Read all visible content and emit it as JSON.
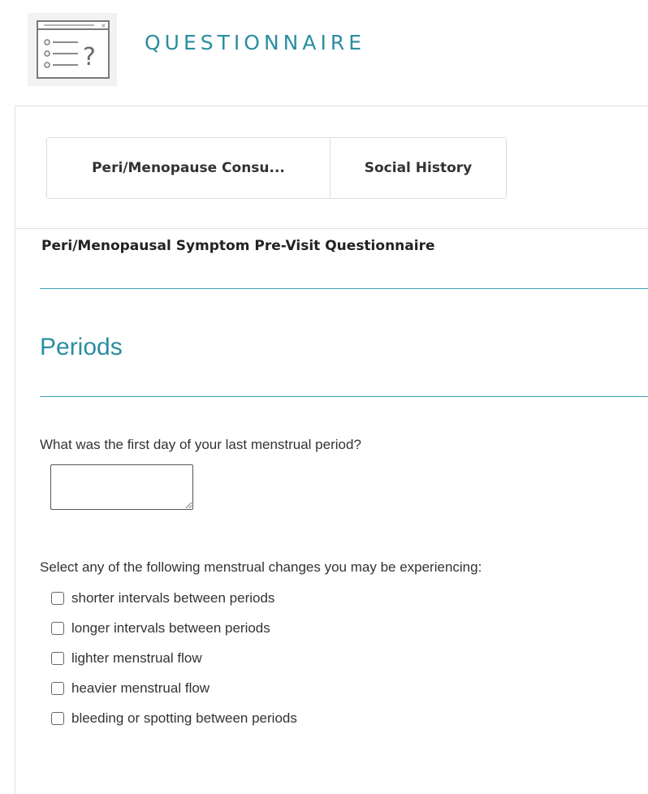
{
  "header": {
    "title": "QUESTIONNAIRE",
    "icon": "questionnaire-icon"
  },
  "tabs": [
    {
      "label": "Peri/Menopause Consu..."
    },
    {
      "label": "Social History"
    }
  ],
  "form": {
    "title": "Peri/Menopausal Symptom Pre-Visit Questionnaire",
    "section": "Periods",
    "question_1": "What was the first day of your last menstrual period?",
    "answer_1": "",
    "question_2": "Select any of the following menstrual changes you may be experiencing:",
    "options": [
      {
        "label": "shorter intervals between periods"
      },
      {
        "label": "longer intervals between periods"
      },
      {
        "label": "lighter menstrual flow"
      },
      {
        "label": "heavier menstrual flow"
      },
      {
        "label": "bleeding or spotting between periods"
      }
    ]
  },
  "colors": {
    "accent": "#2a8ea0",
    "rule": "#3aa3b3",
    "text": "#333333"
  }
}
